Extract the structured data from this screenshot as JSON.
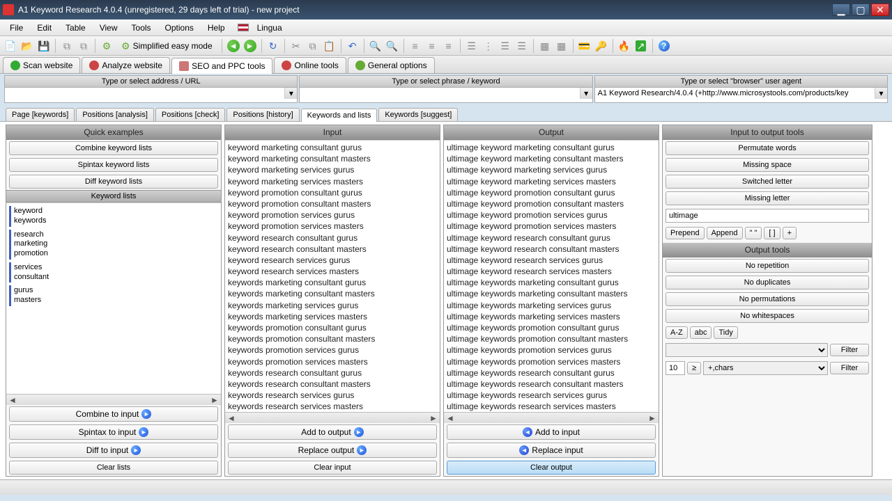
{
  "window": {
    "title": "A1 Keyword Research 4.0.4 (unregistered, 29 days left of trial) - new project"
  },
  "menu": [
    "File",
    "Edit",
    "Table",
    "View",
    "Tools",
    "Options",
    "Help"
  ],
  "lingua": "Lingua",
  "simplified": "Simplified easy mode",
  "maintabs": [
    "Scan website",
    "Analyze website",
    "SEO and PPC tools",
    "Online tools",
    "General options"
  ],
  "addr": {
    "url_label": "Type or select address / URL",
    "phrase_label": "Type or select phrase / keyword",
    "agent_label": "Type or select \"browser\" user agent",
    "agent_value": "A1 Keyword Research/4.0.4 (+http://www.microsystools.com/products/key"
  },
  "subtabs": [
    "Page [keywords]",
    "Positions [analysis]",
    "Positions [check]",
    "Positions [history]",
    "Keywords and lists",
    "Keywords [suggest]"
  ],
  "quick": {
    "header": "Quick examples",
    "combine": "Combine keyword lists",
    "spintax": "Spintax keyword lists",
    "diff": "Diff keyword lists",
    "lists_header": "Keyword lists",
    "groups": [
      [
        "keyword",
        "keywords"
      ],
      [
        "research",
        "marketing",
        "promotion"
      ],
      [
        "services",
        "consultant"
      ],
      [
        "gurus",
        "masters"
      ]
    ],
    "combine_input": "Combine to input",
    "spintax_input": "Spintax to input",
    "diff_input": "Diff to input",
    "clear": "Clear lists"
  },
  "input": {
    "header": "Input",
    "lines": [
      "keyword marketing consultant gurus",
      "keyword marketing consultant masters",
      "keyword marketing services gurus",
      "keyword marketing services masters",
      "keyword promotion consultant gurus",
      "keyword promotion consultant masters",
      "keyword promotion services gurus",
      "keyword promotion services masters",
      "keyword research consultant gurus",
      "keyword research consultant masters",
      "keyword research services gurus",
      "keyword research services masters",
      "keywords marketing consultant gurus",
      "keywords marketing consultant masters",
      "keywords marketing services gurus",
      "keywords marketing services masters",
      "keywords promotion consultant gurus",
      "keywords promotion consultant masters",
      "keywords promotion services gurus",
      "keywords promotion services masters",
      "keywords research consultant gurus",
      "keywords research consultant masters",
      "keywords research services gurus",
      "keywords research services masters"
    ],
    "add_output": "Add to output",
    "replace_output": "Replace output",
    "clear": "Clear input"
  },
  "output": {
    "header": "Output",
    "lines": [
      "ultimage keyword marketing consultant gurus",
      "ultimage keyword marketing consultant masters",
      "ultimage keyword marketing services gurus",
      "ultimage keyword marketing services masters",
      "ultimage keyword promotion consultant gurus",
      "ultimage keyword promotion consultant masters",
      "ultimage keyword promotion services gurus",
      "ultimage keyword promotion services masters",
      "ultimage keyword research consultant gurus",
      "ultimage keyword research consultant masters",
      "ultimage keyword research services gurus",
      "ultimage keyword research services masters",
      "ultimage keywords marketing consultant gurus",
      "ultimage keywords marketing consultant masters",
      "ultimage keywords marketing services gurus",
      "ultimage keywords marketing services masters",
      "ultimage keywords promotion consultant gurus",
      "ultimage keywords promotion consultant masters",
      "ultimage keywords promotion services gurus",
      "ultimage keywords promotion services masters",
      "ultimage keywords research consultant gurus",
      "ultimage keywords research consultant masters",
      "ultimage keywords research services gurus",
      "ultimage keywords research services masters"
    ],
    "add_input": "Add to input",
    "replace_input": "Replace input",
    "clear": "Clear output"
  },
  "tools": {
    "io_header": "Input to output tools",
    "permutate": "Permutate words",
    "missing_space": "Missing space",
    "switched": "Switched letter",
    "missing_letter": "Missing letter",
    "text_value": "ultimage",
    "prepend": "Prepend",
    "append": "Append",
    "quotes": "\" \"",
    "brackets": "[ ]",
    "plus": "+",
    "out_header": "Output tools",
    "norep": "No repetition",
    "nodup": "No duplicates",
    "noperm": "No permutations",
    "nowhite": "No whitespaces",
    "az": "A-Z",
    "abc": "abc",
    "tidy": "Tidy",
    "filter": "Filter",
    "num": "10",
    "ge": "≥",
    "chars": "+,chars"
  }
}
